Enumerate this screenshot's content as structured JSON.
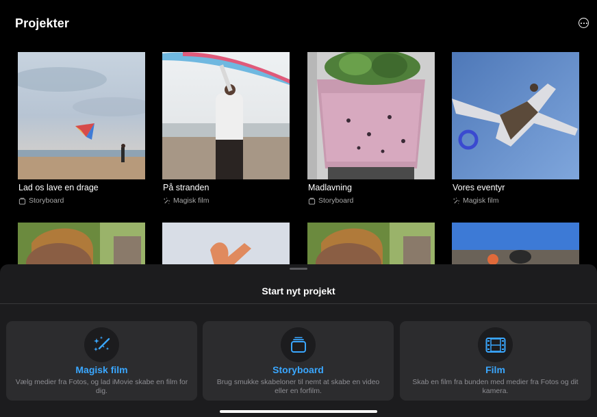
{
  "header": {
    "title": "Projekter",
    "more_icon": "ellipsis-circle-icon"
  },
  "projects": [
    {
      "title": "Lad os lave en drage",
      "type": "Storyboard",
      "type_icon": "storyboard-icon"
    },
    {
      "title": "På stranden",
      "type": "Magisk film",
      "type_icon": "magic-wand-icon"
    },
    {
      "title": "Madlavning",
      "type": "Storyboard",
      "type_icon": "storyboard-icon"
    },
    {
      "title": "Vores eventyr",
      "type": "Magisk film",
      "type_icon": "magic-wand-icon"
    }
  ],
  "sheet": {
    "title": "Start nyt projekt",
    "options": [
      {
        "label": "Magisk film",
        "description": "Vælg medier fra Fotos, og lad iMovie skabe en film for dig.",
        "icon": "magic-wand-icon"
      },
      {
        "label": "Storyboard",
        "description": "Brug smukke skabeloner til nemt at skabe en video eller en forfilm.",
        "icon": "storyboard-icon"
      },
      {
        "label": "Film",
        "description": "Skab en film fra bunden med medier fra Fotos og dit kamera.",
        "icon": "film-icon"
      }
    ]
  },
  "colors": {
    "accent": "#3aa7ff",
    "sheet_bg": "#1c1c1e",
    "card_bg": "#2c2c2e",
    "secondary_text": "#8e8e93"
  }
}
